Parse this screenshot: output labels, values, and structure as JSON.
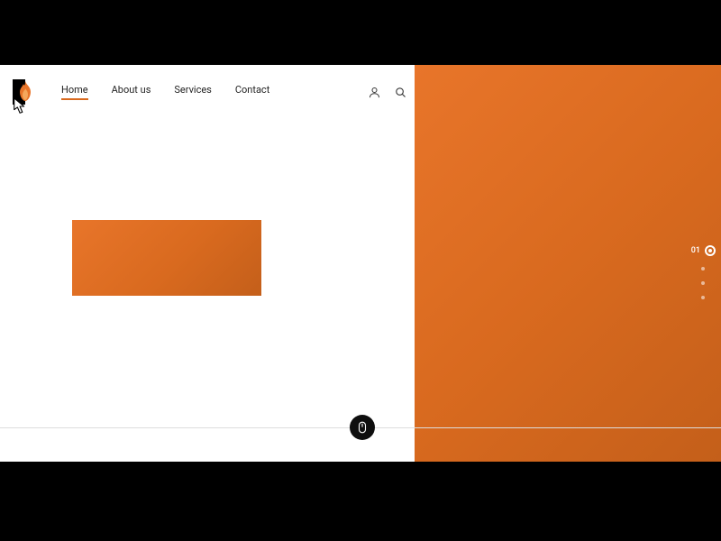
{
  "nav": {
    "items": [
      {
        "label": "Home",
        "active": true
      },
      {
        "label": "About us",
        "active": false
      },
      {
        "label": "Services",
        "active": false
      },
      {
        "label": "Contact",
        "active": false
      }
    ]
  },
  "pager": {
    "active_label": "01",
    "total": 4
  },
  "colors": {
    "accent": "#d96a1f"
  }
}
